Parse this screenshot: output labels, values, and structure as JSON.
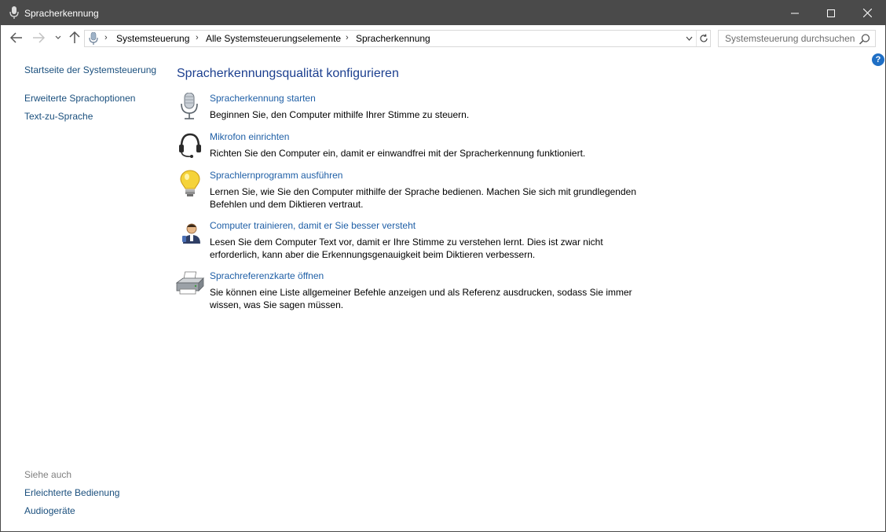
{
  "window": {
    "title": "Spracherkennung"
  },
  "address": {
    "breadcrumbs": [
      "Systemsteuerung",
      "Alle Systemsteuerungselemente",
      "Spracherkennung"
    ]
  },
  "search": {
    "placeholder": "Systemsteuerung durchsuchen"
  },
  "help": {
    "label": "?"
  },
  "leftnav": {
    "home": "Startseite der Systemsteuerung",
    "items": [
      "Erweiterte Sprachoptionen",
      "Text-zu-Sprache"
    ]
  },
  "seealso": {
    "title": "Siehe auch",
    "items": [
      "Erleichterte Bedienung",
      "Audiogeräte"
    ]
  },
  "main": {
    "title": "Spracherkennungsqualität konfigurieren",
    "tasks": [
      {
        "link": "Spracherkennung starten",
        "desc": "Beginnen Sie, den Computer mithilfe Ihrer Stimme zu steuern.",
        "icon": "microphone-icon"
      },
      {
        "link": "Mikrofon einrichten",
        "desc": "Richten Sie den Computer ein, damit er einwandfrei mit der Spracherkennung funktioniert.",
        "icon": "headset-icon"
      },
      {
        "link": "Sprachlernprogramm ausführen",
        "desc": "Lernen Sie, wie Sie den Computer mithilfe der Sprache bedienen. Machen Sie sich mit grundlegenden Befehlen und dem Diktieren vertraut.",
        "icon": "lightbulb-icon"
      },
      {
        "link": "Computer trainieren, damit er Sie besser versteht",
        "desc": "Lesen Sie dem Computer Text vor, damit er Ihre Stimme zu verstehen lernt. Dies ist zwar nicht erforderlich, kann aber die Erkennungsgenauigkeit beim Diktieren verbessern.",
        "icon": "user-training-icon"
      },
      {
        "link": "Sprachreferenzkarte öffnen",
        "desc": "Sie können eine Liste allgemeiner Befehle anzeigen und als Referenz ausdrucken, sodass Sie immer wissen, was Sie sagen müssen.",
        "icon": "printer-icon"
      }
    ]
  },
  "colors": {
    "titlebar": "#4a4a4a",
    "link": "#1f5fa6",
    "heading": "#1c3f8f",
    "help": "#1f6fc5"
  }
}
